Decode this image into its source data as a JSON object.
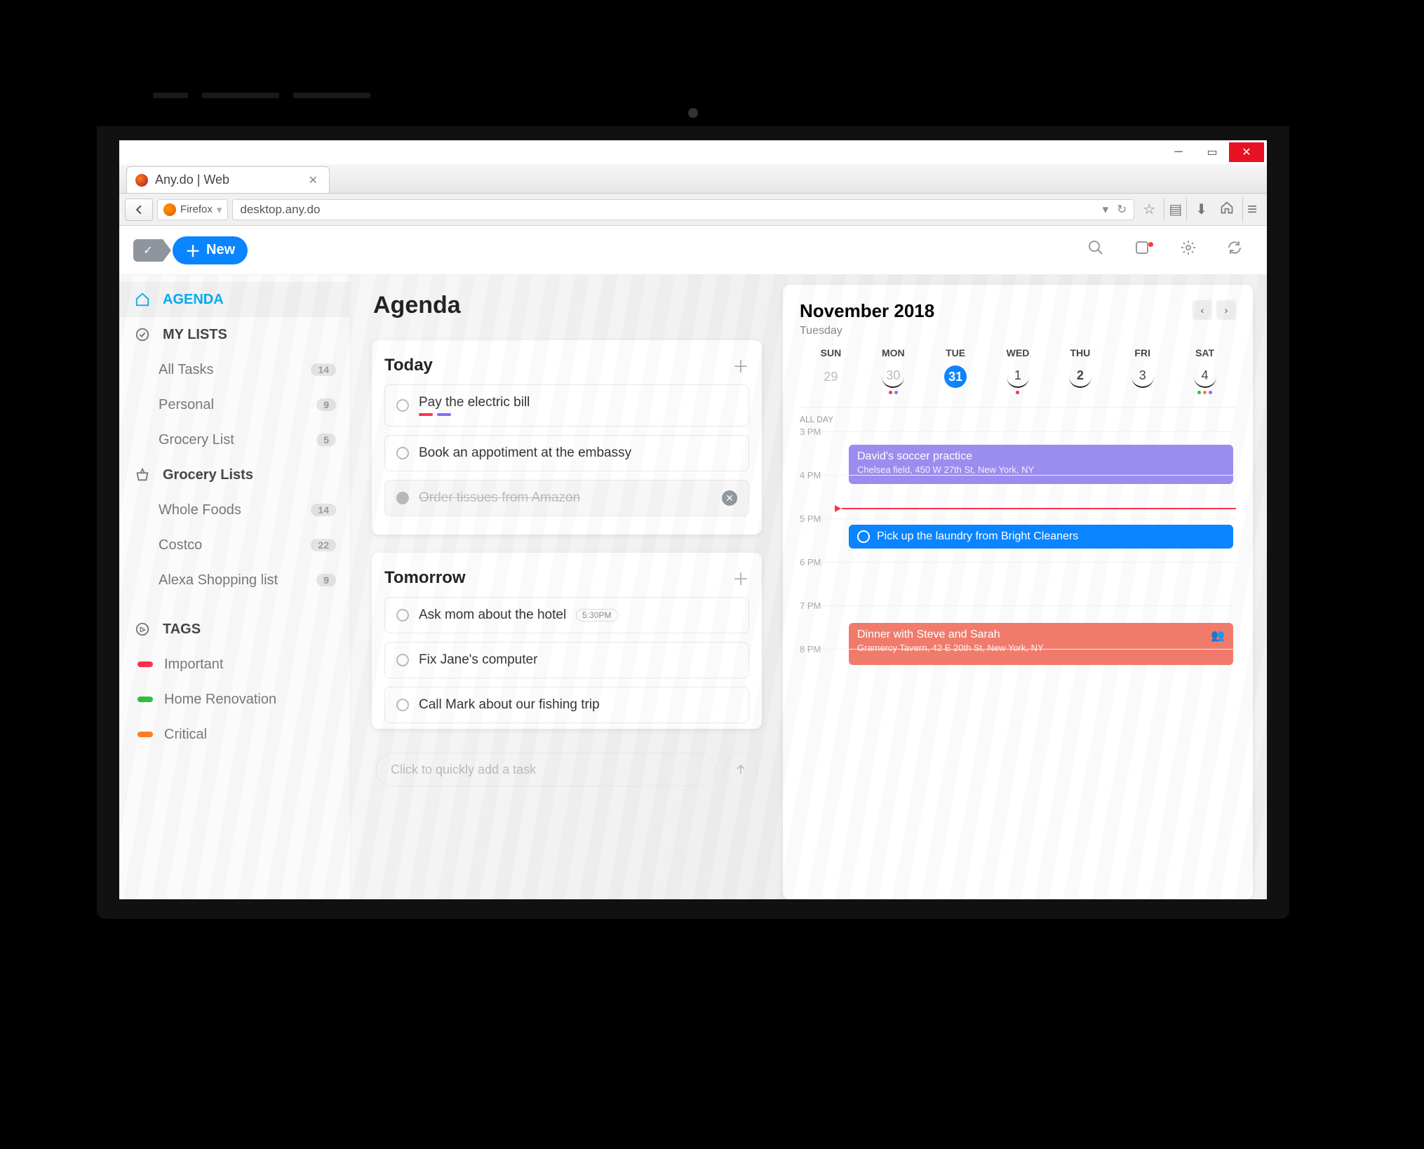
{
  "browser": {
    "tab_title": "Any.do | Web",
    "nav_label": "Firefox",
    "url": "desktop.any.do"
  },
  "toolbar": {
    "new_label": "New"
  },
  "sidebar": {
    "agenda_label": "AGENDA",
    "mylists_label": "MY LISTS",
    "lists": [
      {
        "label": "All Tasks",
        "count": "14"
      },
      {
        "label": "Personal",
        "count": "9"
      },
      {
        "label": "Grocery List",
        "count": "5"
      }
    ],
    "grocery_label": "Grocery Lists",
    "grocery": [
      {
        "label": "Whole Foods",
        "count": "14"
      },
      {
        "label": "Costco",
        "count": "22"
      },
      {
        "label": "Alexa Shopping list",
        "count": "9"
      }
    ],
    "tags_label": "TAGS",
    "tags": [
      {
        "label": "Important",
        "color": "#ff314a"
      },
      {
        "label": "Home Renovation",
        "color": "#2dbf3c"
      },
      {
        "label": "Critical",
        "color": "#ff7b1c"
      }
    ]
  },
  "agenda": {
    "title": "Agenda",
    "today_label": "Today",
    "tomorrow_label": "Tomorrow",
    "today": [
      {
        "name": "Pay the electric bill",
        "tags": [
          "#ff314a",
          "#8d6cff"
        ]
      },
      {
        "name": "Book an appotiment at the embassy"
      },
      {
        "name": "Order tissues from Amazon",
        "done": true
      }
    ],
    "tomorrow": [
      {
        "name": "Ask mom about the hotel",
        "time": "5:30PM"
      },
      {
        "name": "Fix Jane's computer"
      },
      {
        "name": "Call Mark about our fishing trip"
      }
    ],
    "quick_add_placeholder": "Click to quickly add a task"
  },
  "calendar": {
    "title": "November 2018",
    "day": "Tuesday",
    "weekdays": [
      "SUN",
      "MON",
      "TUE",
      "WED",
      "THU",
      "FRI",
      "SAT"
    ],
    "dates": [
      {
        "d": "29",
        "dim": true
      },
      {
        "d": "30",
        "dim": true,
        "dots": [
          "#ff314a",
          "#8d6cff"
        ]
      },
      {
        "d": "31",
        "today": true
      },
      {
        "d": "1",
        "undln": true,
        "dots": [
          "#ff314a"
        ]
      },
      {
        "d": "2",
        "undln": true
      },
      {
        "d": "3",
        "undln": true
      },
      {
        "d": "4",
        "undln": true,
        "dots": [
          "#2dbf3c",
          "#ff7b1c",
          "#8d6cff"
        ]
      }
    ],
    "allday_label": "ALL DAY",
    "hours": [
      "3 PM",
      "4 PM",
      "5 PM",
      "6 PM",
      "7 PM",
      "8 PM"
    ],
    "events": {
      "soccer": {
        "title": "David's soccer practice",
        "sub": "Chelsea field, 450 W 27th St, New York, NY"
      },
      "laundry": {
        "title": "Pick up the laundry from Bright Cleaners"
      },
      "dinner": {
        "title": "Dinner with Steve and Sarah",
        "sub": "Gramercy Tavern, 42 E 20th St, New York, NY"
      }
    }
  }
}
